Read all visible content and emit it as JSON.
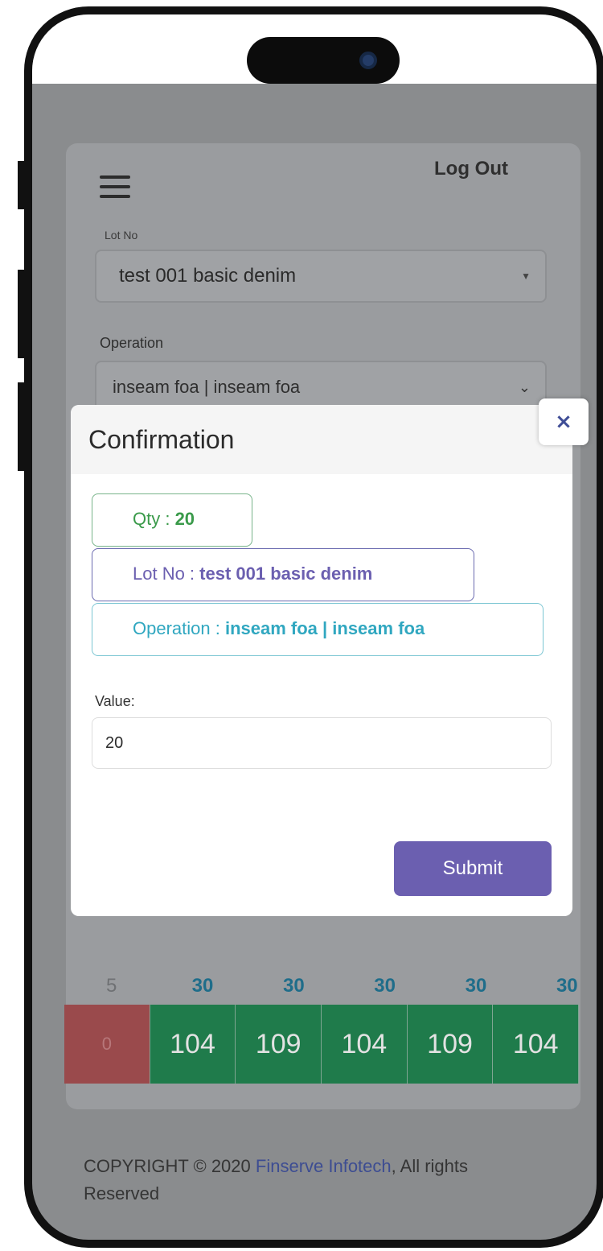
{
  "header": {
    "logout_label": "Log Out"
  },
  "form": {
    "lot_label": "Lot No",
    "lot_value": "test 001 basic denim",
    "operation_label": "Operation",
    "operation_value": "inseam foa | inseam foa"
  },
  "table": {
    "values_row": [
      "5",
      "30",
      "30",
      "30",
      "30",
      "30"
    ],
    "counts_row": [
      "0",
      "104",
      "109",
      "104",
      "109",
      "104"
    ]
  },
  "footer": {
    "prefix": "COPYRIGHT © 2020 ",
    "brand": "Finserve Infotech",
    "suffix": ", All rights Reserved"
  },
  "modal": {
    "title": "Confirmation",
    "close_symbol": "×",
    "qty_label": "Qty : ",
    "qty_value": "20",
    "lot_label": "Lot No : ",
    "lot_value": "test 001 basic denim",
    "operation_label": "Operation : ",
    "operation_value": "inseam foa | inseam foa",
    "value_label": "Value:",
    "value_input": "20",
    "submit_label": "Submit"
  },
  "colors": {
    "accent_purple": "#6b5fb0",
    "green_cell": "#1f7b4b",
    "red_cell": "#9a4a4c"
  }
}
